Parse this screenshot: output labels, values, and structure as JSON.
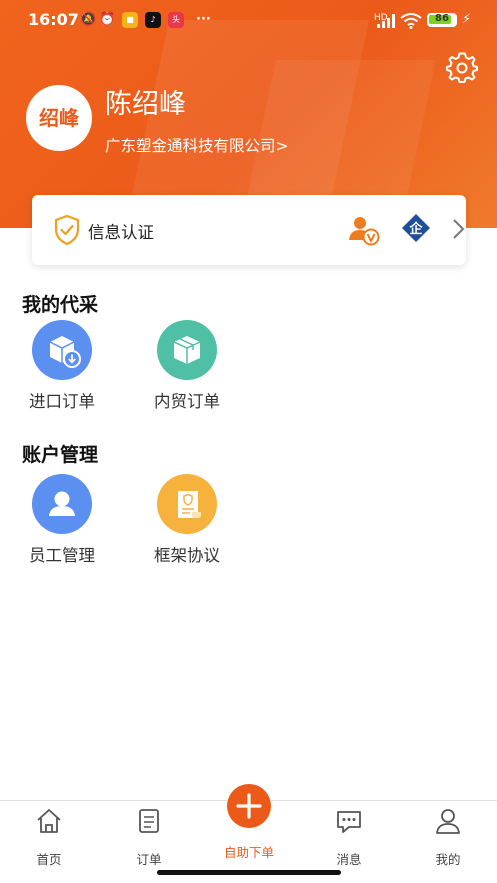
{
  "status_bar": {
    "time": "16:07",
    "network": "HD",
    "battery_level": 86,
    "battery_label": "86"
  },
  "profile": {
    "avatar_text": "绍峰",
    "name": "陈绍峰",
    "company": "广东塑金通科技有限公司",
    "company_arrow": ">"
  },
  "verification": {
    "label": "信息认证",
    "enterprise_badge": "企"
  },
  "sections": [
    {
      "title": "我的代采",
      "items": [
        {
          "label": "进口订单",
          "icon": "import-box-icon",
          "color": "#5b8ff0"
        },
        {
          "label": "内贸订单",
          "icon": "domestic-box-icon",
          "color": "#4fbfa5"
        }
      ]
    },
    {
      "title": "账户管理",
      "items": [
        {
          "label": "员工管理",
          "icon": "employee-icon",
          "color": "#5b8ff0"
        },
        {
          "label": "框架协议",
          "icon": "agreement-scroll-icon",
          "color": "#f7b23d"
        }
      ]
    }
  ],
  "tabbar": {
    "home": "首页",
    "orders": "订单",
    "self_order": "自助下单",
    "messages": "消息",
    "mine": "我的"
  },
  "colors": {
    "accent": "#ec5a19",
    "header": "#f0641e"
  }
}
